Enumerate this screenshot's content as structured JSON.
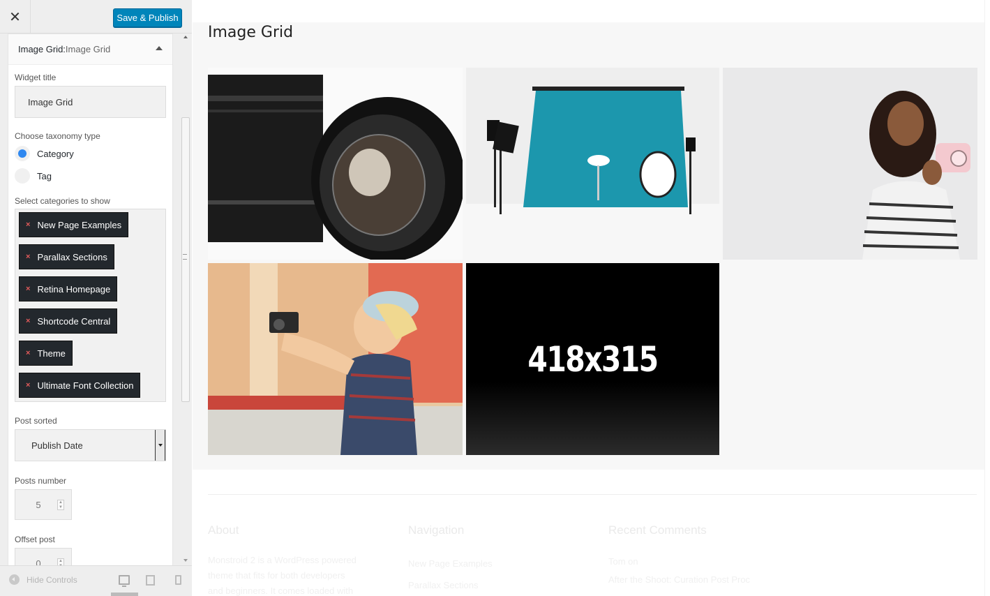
{
  "header": {
    "close_glyph": "✕",
    "publish_label": "Save & Publish"
  },
  "widget": {
    "title_prefix": "Image Grid:",
    "title_name": " Image Grid",
    "widget_title_label": "Widget title",
    "widget_title_value": "Image Grid",
    "taxonomy_label": "Choose taxonomy type",
    "taxonomy_options": [
      "Category",
      "Tag"
    ],
    "taxonomy_selected": "Category",
    "categories_label": "Select categories to show",
    "categories": [
      "New Page Examples",
      "Parallax Sections",
      "Retina Homepage",
      "Shortcode Central",
      "Theme",
      "Ultimate Font Collection"
    ],
    "remove_glyph": "×",
    "sorted_label": "Post sorted",
    "sorted_value": "Publish Date",
    "posts_number_label": "Posts number",
    "posts_number_value": "5",
    "offset_label": "Offset post",
    "offset_value": "0"
  },
  "footer_controls": {
    "hide_label": "Hide Controls"
  },
  "preview": {
    "section_title": "Image Grid",
    "placeholder_text": "418x315",
    "footer_cols": [
      {
        "title": "About",
        "lines": [
          "Monstroid 2 is a WordPress powered",
          "theme that fits for both developers",
          "and beginners. It comes loaded with"
        ]
      },
      {
        "title": "Navigation",
        "lines": [
          "New Page Examples",
          "Parallax Sections"
        ]
      },
      {
        "title": "Recent Comments",
        "lines": [
          "Tom on",
          "After the Shoot: Curation Post Proc"
        ]
      }
    ]
  },
  "colors": {
    "accent": "#0085ba",
    "chip_bg": "#23282d",
    "chip_x": "#e35b5b",
    "radio_on": "#2f88f0",
    "studio_teal": "#1c97ad"
  }
}
